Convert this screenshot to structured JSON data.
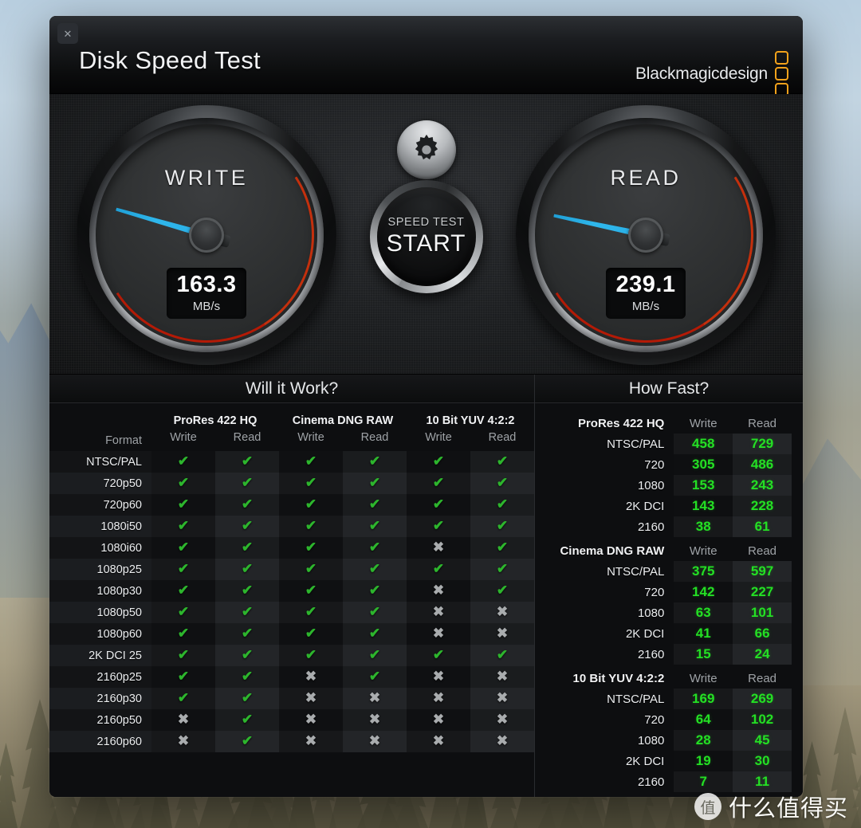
{
  "window": {
    "title": "Disk Speed Test",
    "close_label": "✕",
    "brand": "Blackmagicdesign"
  },
  "gauges": {
    "write": {
      "label": "WRITE",
      "value": "163.3",
      "unit": "MB/s",
      "needle_deg": 196
    },
    "read": {
      "label": "READ",
      "value": "239.1",
      "unit": "MB/s",
      "needle_deg": 192
    }
  },
  "controls": {
    "gear_icon": "gear-icon",
    "start_sub": "SPEED TEST",
    "start_main": "START"
  },
  "will_it_work": {
    "heading": "Will it Work?",
    "format_header": "Format",
    "groups": [
      "ProRes 422 HQ",
      "Cinema DNG RAW",
      "10 Bit YUV 4:2:2"
    ],
    "sub_headers": [
      "Write",
      "Read",
      "Write",
      "Read",
      "Write",
      "Read"
    ],
    "ok_glyph": "✔",
    "no_glyph": "✖",
    "rows": [
      {
        "format": "NTSC/PAL",
        "cells": [
          true,
          true,
          true,
          true,
          true,
          true
        ]
      },
      {
        "format": "720p50",
        "cells": [
          true,
          true,
          true,
          true,
          true,
          true
        ]
      },
      {
        "format": "720p60",
        "cells": [
          true,
          true,
          true,
          true,
          true,
          true
        ]
      },
      {
        "format": "1080i50",
        "cells": [
          true,
          true,
          true,
          true,
          true,
          true
        ]
      },
      {
        "format": "1080i60",
        "cells": [
          true,
          true,
          true,
          true,
          false,
          true
        ]
      },
      {
        "format": "1080p25",
        "cells": [
          true,
          true,
          true,
          true,
          true,
          true
        ]
      },
      {
        "format": "1080p30",
        "cells": [
          true,
          true,
          true,
          true,
          false,
          true
        ]
      },
      {
        "format": "1080p50",
        "cells": [
          true,
          true,
          true,
          true,
          false,
          false
        ]
      },
      {
        "format": "1080p60",
        "cells": [
          true,
          true,
          true,
          true,
          false,
          false
        ]
      },
      {
        "format": "2K DCI 25",
        "cells": [
          true,
          true,
          true,
          true,
          true,
          true
        ]
      },
      {
        "format": "2160p25",
        "cells": [
          true,
          true,
          false,
          true,
          false,
          false
        ]
      },
      {
        "format": "2160p30",
        "cells": [
          true,
          true,
          false,
          false,
          false,
          false
        ]
      },
      {
        "format": "2160p50",
        "cells": [
          false,
          true,
          false,
          false,
          false,
          false
        ]
      },
      {
        "format": "2160p60",
        "cells": [
          false,
          true,
          false,
          false,
          false,
          false
        ]
      }
    ]
  },
  "how_fast": {
    "heading": "How Fast?",
    "col_write": "Write",
    "col_read": "Read",
    "groups": [
      {
        "name": "ProRes 422 HQ",
        "rows": [
          {
            "res": "NTSC/PAL",
            "write": "458",
            "read": "729"
          },
          {
            "res": "720",
            "write": "305",
            "read": "486"
          },
          {
            "res": "1080",
            "write": "153",
            "read": "243"
          },
          {
            "res": "2K DCI",
            "write": "143",
            "read": "228"
          },
          {
            "res": "2160",
            "write": "38",
            "read": "61"
          }
        ]
      },
      {
        "name": "Cinema DNG RAW",
        "rows": [
          {
            "res": "NTSC/PAL",
            "write": "375",
            "read": "597"
          },
          {
            "res": "720",
            "write": "142",
            "read": "227"
          },
          {
            "res": "1080",
            "write": "63",
            "read": "101"
          },
          {
            "res": "2K DCI",
            "write": "41",
            "read": "66"
          },
          {
            "res": "2160",
            "write": "15",
            "read": "24"
          }
        ]
      },
      {
        "name": "10 Bit YUV 4:2:2",
        "rows": [
          {
            "res": "NTSC/PAL",
            "write": "169",
            "read": "269"
          },
          {
            "res": "720",
            "write": "64",
            "read": "102"
          },
          {
            "res": "1080",
            "write": "28",
            "read": "45"
          },
          {
            "res": "2K DCI",
            "write": "19",
            "read": "30"
          },
          {
            "res": "2160",
            "write": "7",
            "read": "11"
          }
        ]
      }
    ]
  },
  "watermark": {
    "badge": "值",
    "text": "什么值得买"
  },
  "colors": {
    "accent_orange": "#f3a21b",
    "needle_blue": "#2fb7ec",
    "value_green": "#24e024",
    "check_green": "#2db52d",
    "cross_gray": "#a9acae"
  }
}
